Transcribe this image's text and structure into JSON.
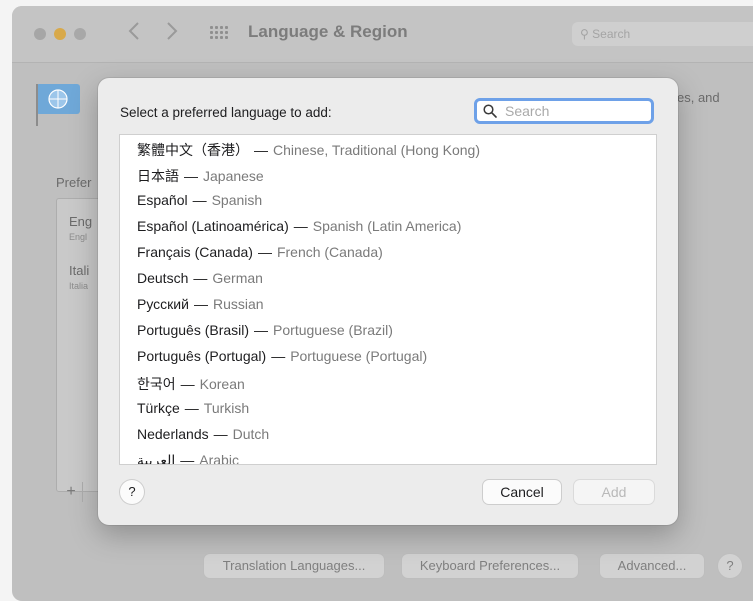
{
  "window": {
    "title": "Language & Region",
    "search_placeholder": "Search",
    "description_fragment": "es, and",
    "preferred_label": "Prefer",
    "preferred_items": [
      {
        "label": "Eng",
        "sub": "Engl"
      },
      {
        "label": "Itali",
        "sub": "Italia"
      }
    ],
    "add_remove": "+",
    "bottom_buttons": [
      "Translation Languages...",
      "Keyboard Preferences...",
      "Advanced..."
    ],
    "help": "?"
  },
  "sheet": {
    "prompt": "Select a preferred language to add:",
    "search_placeholder": "Search",
    "languages": [
      {
        "native": "繁體中文（香港）",
        "english": "Chinese, Traditional (Hong Kong)"
      },
      {
        "native": "日本語",
        "english": "Japanese"
      },
      {
        "native": "Español",
        "english": "Spanish"
      },
      {
        "native": "Español (Latinoamérica)",
        "english": "Spanish (Latin America)"
      },
      {
        "native": "Français (Canada)",
        "english": "French (Canada)"
      },
      {
        "native": "Deutsch",
        "english": "German"
      },
      {
        "native": "Русский",
        "english": "Russian"
      },
      {
        "native": "Português (Brasil)",
        "english": "Portuguese (Brazil)"
      },
      {
        "native": "Português (Portugal)",
        "english": "Portuguese (Portugal)"
      },
      {
        "native": "한국어",
        "english": "Korean"
      },
      {
        "native": "Türkçe",
        "english": "Turkish"
      },
      {
        "native": "Nederlands",
        "english": "Dutch"
      },
      {
        "native": "العربية",
        "english": "Arabic"
      }
    ],
    "dash": "—",
    "help": "?",
    "cancel": "Cancel",
    "add": "Add"
  },
  "icons": {
    "back": "chevron-left-icon",
    "forward": "chevron-right-icon",
    "grid": "show-all-grid-icon",
    "flag": "language-flag-icon",
    "search": "magnifying-glass-icon"
  },
  "colors": {
    "focus_ring": "#6ea1e8",
    "minimize_light": "#d8a94a"
  }
}
